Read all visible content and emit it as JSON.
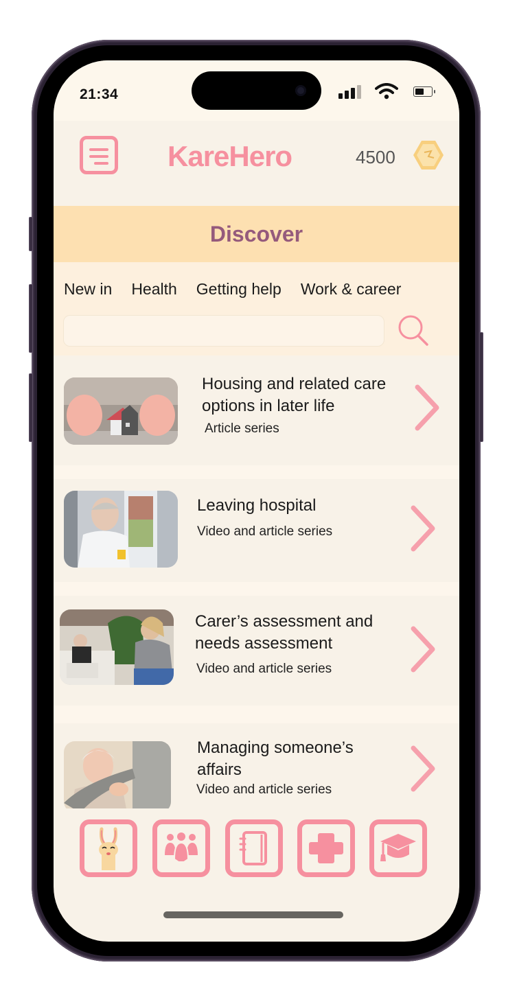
{
  "status_bar": {
    "time": "21:34",
    "signal_icon": "cellular-signal-icon",
    "wifi_icon": "wifi-icon",
    "battery_icon": "battery-icon"
  },
  "header": {
    "menu_icon": "menu-document-icon",
    "logo_text": "KareHero",
    "points": "4500",
    "coin_icon": "hexagon-coin-icon"
  },
  "discover": {
    "title": "Discover"
  },
  "filters": {
    "tabs": [
      {
        "label": "New in"
      },
      {
        "label": "Health"
      },
      {
        "label": "Getting help"
      },
      {
        "label": "Work & career"
      }
    ],
    "search": {
      "value": "",
      "placeholder": "",
      "icon": "search-icon"
    }
  },
  "colors": {
    "accent_pink": "#f6909f",
    "banner_peach": "#fde0b1",
    "title_plum": "#955a7c",
    "background_cream": "#f8f2e8"
  },
  "cards": [
    {
      "title_lines": [
        "Housing and related care",
        "options in later life"
      ],
      "subtitle": "Article series",
      "image": "hands-protecting-house-photo"
    },
    {
      "title_lines": [
        "Leaving hospital"
      ],
      "subtitle": "Video and article series",
      "image": "older-man-by-window-photo"
    },
    {
      "title_lines": [
        "Carer’s assessment and",
        "needs assessment"
      ],
      "subtitle": "Video and article series",
      "image": "carer-with-older-man-photo"
    },
    {
      "title_lines": [
        "Managing someone’s",
        "affairs"
      ],
      "subtitle": "Video and article series",
      "image": "older-woman-with-carer-photo"
    }
  ],
  "bottom_nav": [
    {
      "name": "llama-mascot-icon"
    },
    {
      "name": "community-group-icon"
    },
    {
      "name": "notebook-icon"
    },
    {
      "name": "medical-cross-icon"
    },
    {
      "name": "graduation-cap-icon"
    }
  ]
}
